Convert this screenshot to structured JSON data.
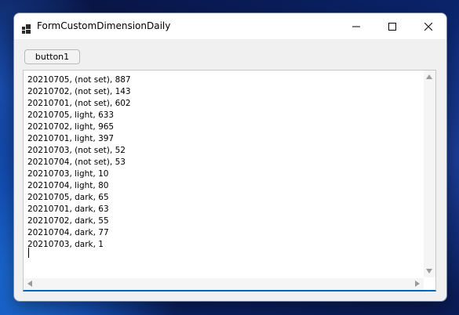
{
  "window": {
    "title": "FormCustomDimensionDaily",
    "icon": "app-window-icon",
    "caption_buttons": [
      "minimize-icon",
      "maximize-icon",
      "close-icon"
    ]
  },
  "toolbar": {
    "button1_label": "button1"
  },
  "output": {
    "lines": [
      "20210705, (not set), 887",
      "20210702, (not set), 143",
      "20210701, (not set), 602",
      "20210705, light, 633",
      "20210702, light, 965",
      "20210701, light, 397",
      "20210703, (not set), 52",
      "20210704, (not set), 53",
      "20210703, light, 10",
      "20210704, light, 80",
      "20210705, dark, 65",
      "20210701, dark, 63",
      "20210702, dark, 55",
      "20210704, dark, 77",
      "20210703, dark, 1"
    ]
  },
  "colors": {
    "focus_border": "#0067c0",
    "window_bg": "#f0f0f0",
    "titlebar_bg": "#ffffff"
  }
}
